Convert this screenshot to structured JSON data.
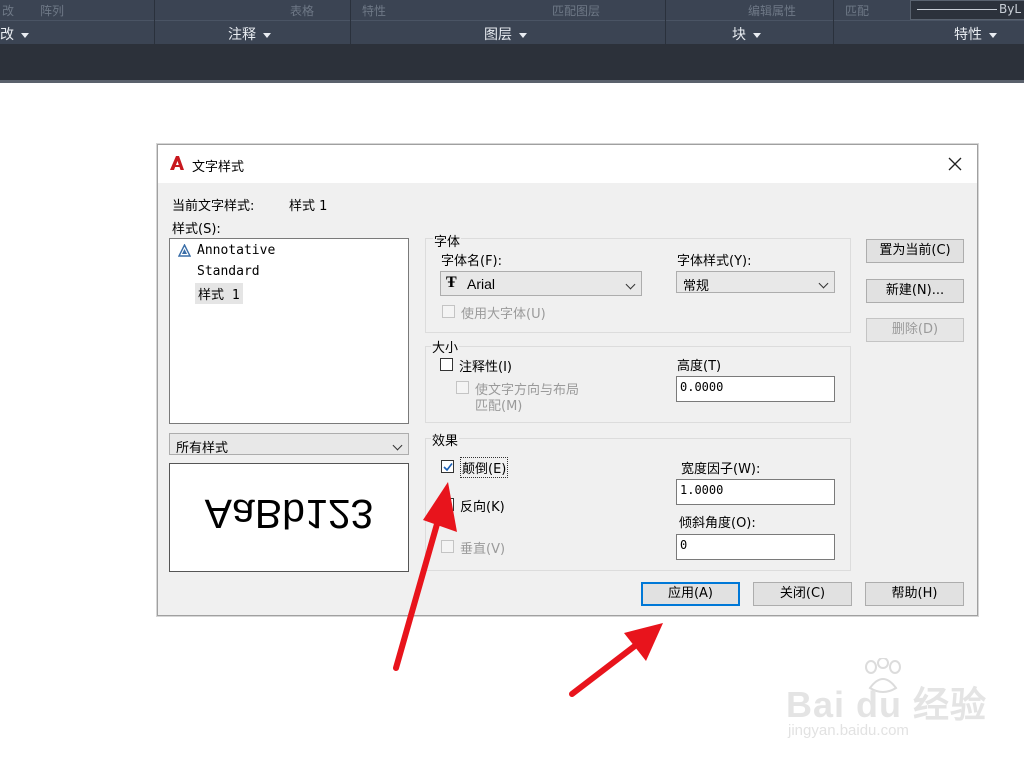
{
  "ribbon": {
    "ghost_labels": [
      "改",
      "阵列",
      "表格",
      "特性",
      "匹配图层",
      "编辑属性",
      "匹配",
      "ByL"
    ],
    "panels": [
      "修改",
      "注释",
      "图层",
      "块",
      "特性"
    ]
  },
  "dialog": {
    "title": "文字样式",
    "current_style_label": "当前文字样式:",
    "current_style_value": "样式 1",
    "styles_label": "样式(S):",
    "styles": [
      "Annotative",
      "Standard",
      "样式 1"
    ],
    "filter_value": "所有样式",
    "preview_text": "AaBb123",
    "font_group": {
      "title": "字体",
      "font_name_label": "字体名(F):",
      "font_name_value": "Arial",
      "font_style_label": "字体样式(Y):",
      "font_style_value": "常规",
      "bigfont_label": "使用大字体(U)"
    },
    "size_group": {
      "title": "大小",
      "annotative_label": "注释性(I)",
      "match_line1": "使文字方向与布局",
      "match_line2": "匹配(M)",
      "height_label": "高度(T)",
      "height_value": "0.0000"
    },
    "effects_group": {
      "title": "效果",
      "upside_down_label": "颠倒(E)",
      "upside_down_checked": true,
      "backwards_label": "反向(K)",
      "vertical_label": "垂直(V)",
      "width_factor_label": "宽度因子(W):",
      "width_factor_value": "1.0000",
      "oblique_label": "倾斜角度(O):",
      "oblique_value": "0"
    },
    "buttons": {
      "set_current": "置为当前(C)",
      "new": "新建(N)...",
      "delete": "删除(D)",
      "apply": "应用(A)",
      "close": "关闭(C)",
      "help": "帮助(H)"
    }
  },
  "watermark": {
    "brand": "Bai du 经验",
    "url": "jingyan.baidu.com"
  },
  "colors": {
    "ribbon_bg": "#3b4453",
    "dialog_bg": "#f0f0f0",
    "annotation_arrow": "#e8141c",
    "focus_blue": "#0078d7"
  }
}
